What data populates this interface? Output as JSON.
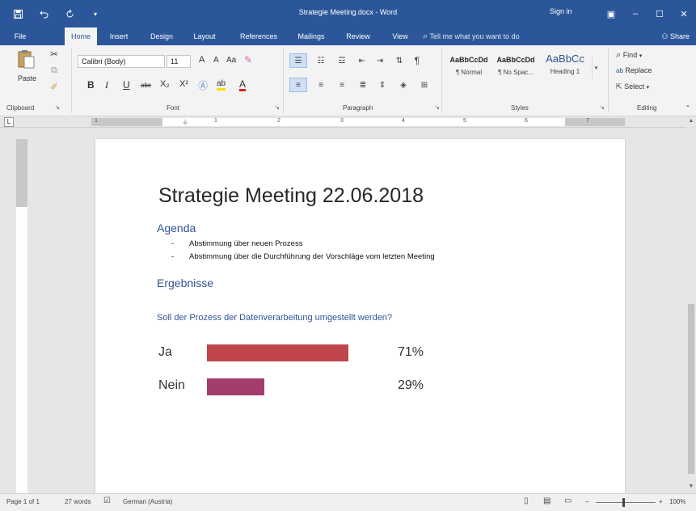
{
  "window": {
    "title": "Strategie Meeting.docx  -  Word",
    "sign_in": "Sign in",
    "qat": {
      "save_icon": "save-icon",
      "undo_icon": "undo-icon",
      "redo_icon": "redo-icon",
      "customize": "▾"
    },
    "buttons": {
      "ribbon_display": "▣",
      "minimize": "–",
      "maximize": "☐",
      "close": "✕"
    }
  },
  "tabs": [
    {
      "label": "File"
    },
    {
      "label": "Home"
    },
    {
      "label": "Insert"
    },
    {
      "label": "Design"
    },
    {
      "label": "Layout"
    },
    {
      "label": "References"
    },
    {
      "label": "Mailings"
    },
    {
      "label": "Review"
    },
    {
      "label": "View"
    }
  ],
  "tell_me": "Tell me what you want to do",
  "share": "Share",
  "ribbon": {
    "clipboard": {
      "label": "Clipboard",
      "paste": "Paste"
    },
    "font": {
      "label": "Font",
      "font_name": "Calibri (Body)",
      "font_size": "11",
      "bold": "B",
      "italic": "I",
      "underline": "U",
      "strike": "abc",
      "subscript": "X₂",
      "superscript": "X²",
      "grow": "A",
      "shrink": "A",
      "case": "Aa",
      "highlight": "ab",
      "font_color": "A"
    },
    "paragraph": {
      "label": "Paragraph"
    },
    "styles": {
      "label": "Styles",
      "items": [
        {
          "sample": "AaBbCcDd",
          "name": "¶ Normal"
        },
        {
          "sample": "AaBbCcDd",
          "name": "¶ No Spac..."
        },
        {
          "sample": "AaBbCc",
          "name": "Heading 1"
        }
      ]
    },
    "editing": {
      "label": "Editing",
      "find": "Find",
      "replace": "Replace",
      "select": "Select"
    }
  },
  "ruler": {
    "numbers": [
      "1",
      "1",
      "2",
      "3",
      "4",
      "5",
      "6",
      "7"
    ],
    "tab_selector": "L"
  },
  "document": {
    "title": "Strategie Meeting 22.06.2018",
    "agenda_heading": "Agenda",
    "agenda_items": [
      "Abstimmung über neuen Prozess",
      "Abstimmung über die Durchführung der Vorschläge vom letzten Meeting"
    ],
    "results_heading": "Ergebnisse",
    "question": "Soll der Prozess der Datenverarbeitung umgestellt werden?"
  },
  "chart_data": {
    "type": "bar",
    "categories": [
      "Ja",
      "Nein"
    ],
    "values": [
      71,
      29
    ],
    "value_labels": [
      "71%",
      "29%"
    ],
    "colors": [
      "#c0464b",
      "#a33d6e"
    ]
  },
  "status": {
    "page": "Page 1 of 1",
    "words": "27 words",
    "language": "German (Austria)",
    "zoom": "100%",
    "zoom_minus": "–",
    "zoom_plus": "+"
  }
}
